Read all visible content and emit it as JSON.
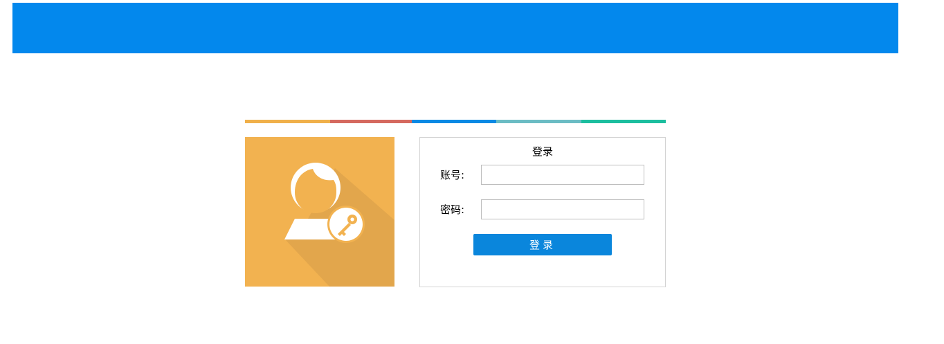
{
  "colors": {
    "header": "#0388ed",
    "strip": [
      "#f0b04a",
      "#d5695f",
      "#0a89e4",
      "#6bbcc4",
      "#1cbe9f"
    ],
    "avatar_bg": "#f2b250",
    "avatar_shadow": "#e2a64c",
    "button": "#0a86dc"
  },
  "login": {
    "title": "登录",
    "account_label": "账号:",
    "account_value": "",
    "password_label": "密码:",
    "password_value": "",
    "button_label": "登录"
  },
  "icons": {
    "avatar": "user-key-icon"
  }
}
